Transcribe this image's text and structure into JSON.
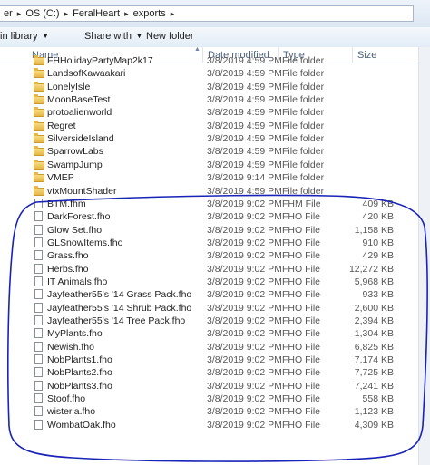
{
  "address": {
    "crumbs": [
      "er",
      "OS (C:)",
      "FeralHeart",
      "exports"
    ]
  },
  "toolbar": {
    "library_label": "in library",
    "share_label": "Share with",
    "new_folder_label": "New folder"
  },
  "columns": {
    "name": "Name",
    "date": "Date modified",
    "type": "Type",
    "size": "Size"
  },
  "folders": [
    {
      "name": "FHHolidayPartyMap2k17",
      "date": "3/8/2019 4:59 PM",
      "type": "File folder"
    },
    {
      "name": "LandsofKawaakari",
      "date": "3/8/2019 4:59 PM",
      "type": "File folder"
    },
    {
      "name": "LonelyIsle",
      "date": "3/8/2019 4:59 PM",
      "type": "File folder"
    },
    {
      "name": "MoonBaseTest",
      "date": "3/8/2019 4:59 PM",
      "type": "File folder"
    },
    {
      "name": "protoalienworld",
      "date": "3/8/2019 4:59 PM",
      "type": "File folder"
    },
    {
      "name": "Regret",
      "date": "3/8/2019 4:59 PM",
      "type": "File folder"
    },
    {
      "name": "SilversideIsland",
      "date": "3/8/2019 4:59 PM",
      "type": "File folder"
    },
    {
      "name": "SparrowLabs",
      "date": "3/8/2019 4:59 PM",
      "type": "File folder"
    },
    {
      "name": "SwampJump",
      "date": "3/8/2019 4:59 PM",
      "type": "File folder"
    },
    {
      "name": "VMEP",
      "date": "3/8/2019 9:14 PM",
      "type": "File folder"
    },
    {
      "name": "vtxMountShader",
      "date": "3/8/2019 4:59 PM",
      "type": "File folder"
    }
  ],
  "files": [
    {
      "name": "BTM.fhm",
      "date": "3/8/2019 9:02 PM",
      "type": "FHM File",
      "size": "409 KB"
    },
    {
      "name": "DarkForest.fho",
      "date": "3/8/2019 9:02 PM",
      "type": "FHO File",
      "size": "420 KB"
    },
    {
      "name": "Glow Set.fho",
      "date": "3/8/2019 9:02 PM",
      "type": "FHO File",
      "size": "1,158 KB"
    },
    {
      "name": "GLSnowItems.fho",
      "date": "3/8/2019 9:02 PM",
      "type": "FHO File",
      "size": "910 KB"
    },
    {
      "name": "Grass.fho",
      "date": "3/8/2019 9:02 PM",
      "type": "FHO File",
      "size": "429 KB"
    },
    {
      "name": "Herbs.fho",
      "date": "3/8/2019 9:02 PM",
      "type": "FHO File",
      "size": "12,272 KB"
    },
    {
      "name": "IT Animals.fho",
      "date": "3/8/2019 9:02 PM",
      "type": "FHO File",
      "size": "5,968 KB"
    },
    {
      "name": "Jayfeather55's '14 Grass Pack.fho",
      "date": "3/8/2019 9:02 PM",
      "type": "FHO File",
      "size": "933 KB"
    },
    {
      "name": "Jayfeather55's '14 Shrub Pack.fho",
      "date": "3/8/2019 9:02 PM",
      "type": "FHO File",
      "size": "2,600 KB"
    },
    {
      "name": "Jayfeather55's '14 Tree Pack.fho",
      "date": "3/8/2019 9:02 PM",
      "type": "FHO File",
      "size": "2,394 KB"
    },
    {
      "name": "MyPlants.fho",
      "date": "3/8/2019 9:02 PM",
      "type": "FHO File",
      "size": "1,304 KB"
    },
    {
      "name": "Newish.fho",
      "date": "3/8/2019 9:02 PM",
      "type": "FHO File",
      "size": "6,825 KB"
    },
    {
      "name": "NobPlants1.fho",
      "date": "3/8/2019 9:02 PM",
      "type": "FHO File",
      "size": "7,174 KB"
    },
    {
      "name": "NobPlants2.fho",
      "date": "3/8/2019 9:02 PM",
      "type": "FHO File",
      "size": "7,725 KB"
    },
    {
      "name": "NobPlants3.fho",
      "date": "3/8/2019 9:02 PM",
      "type": "FHO File",
      "size": "7,241 KB"
    },
    {
      "name": "Stoof.fho",
      "date": "3/8/2019 9:02 PM",
      "type": "FHO File",
      "size": "558 KB"
    },
    {
      "name": "wisteria.fho",
      "date": "3/8/2019 9:02 PM",
      "type": "FHO File",
      "size": "1,123 KB"
    },
    {
      "name": "WombatOak.fho",
      "date": "3/8/2019 9:02 PM",
      "type": "FHO File",
      "size": "4,309 KB"
    }
  ],
  "icons": {
    "folder": "folder-icon",
    "file": "file-icon",
    "separator": "chevron-right-icon",
    "dropdown": "chevron-down-icon",
    "annotation_color": "#1a23b8"
  }
}
